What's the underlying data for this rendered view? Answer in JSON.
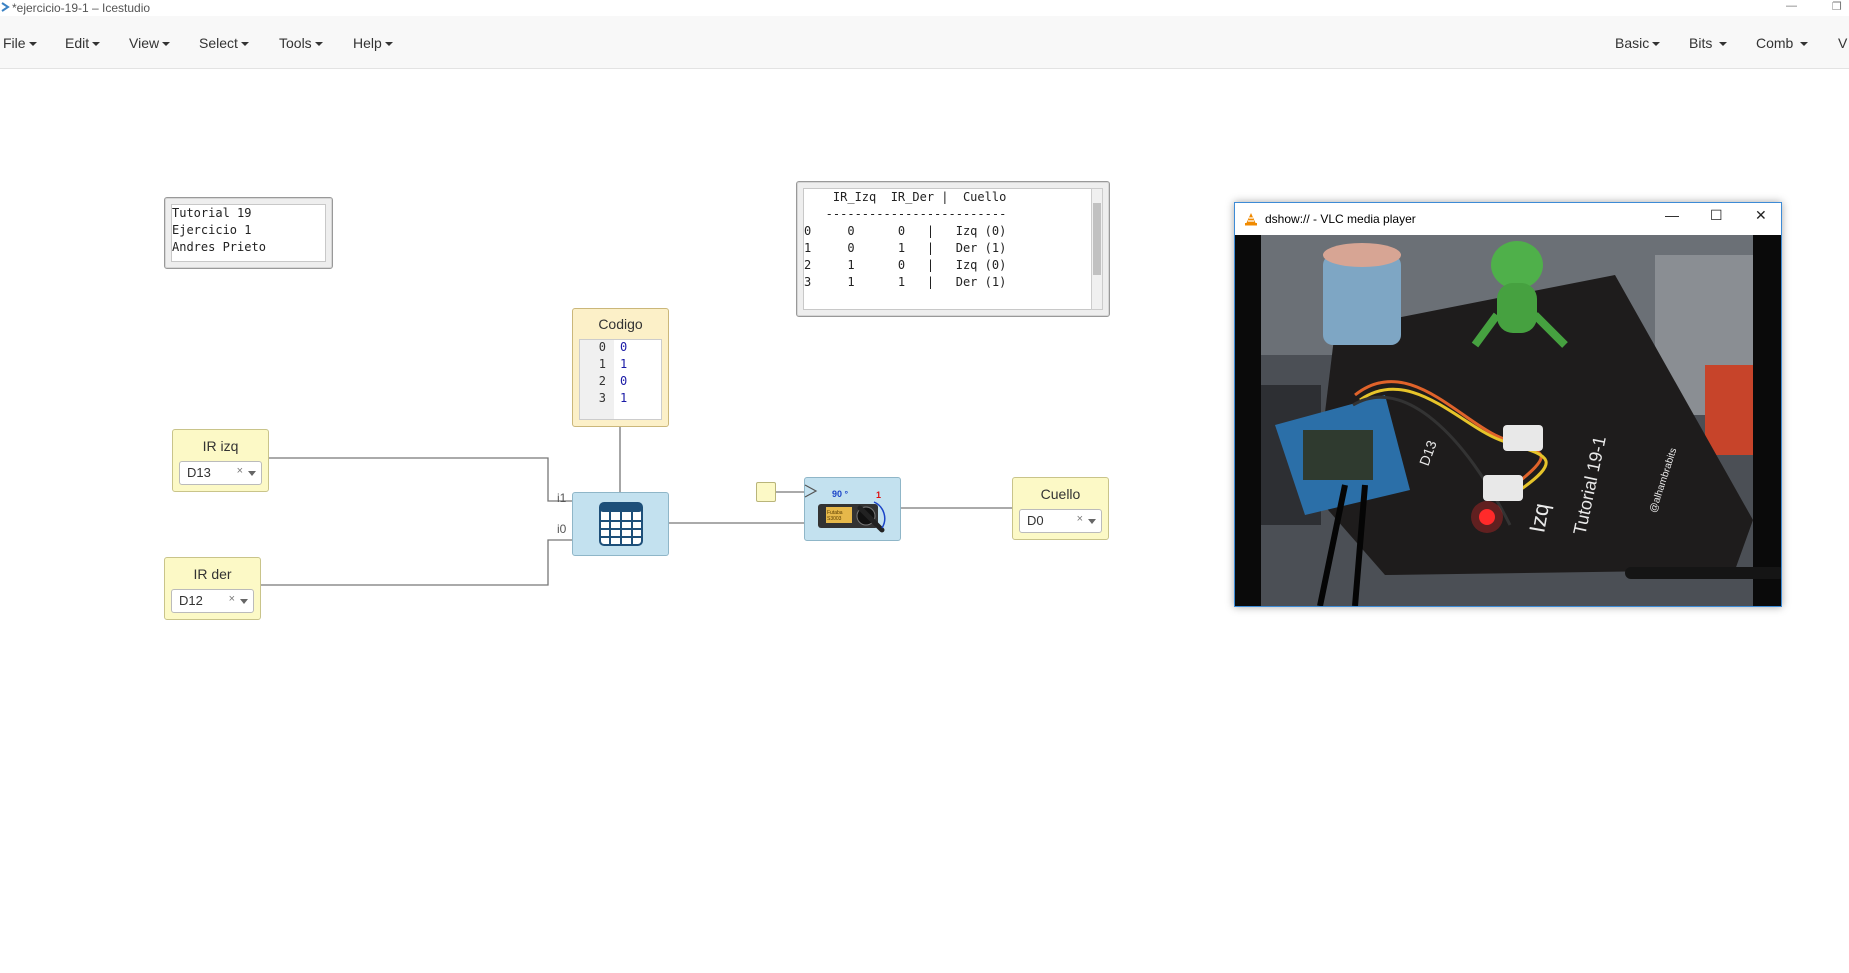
{
  "window": {
    "title": "*ejercicio-19-1 – Icestudio",
    "minimize_glyph": "—",
    "restore_glyph": "❐"
  },
  "menubar": {
    "left": [
      "File",
      "Edit",
      "View",
      "Select",
      "Tools",
      "Help"
    ],
    "right": [
      "Basic",
      "Bits",
      "Comb",
      "V"
    ]
  },
  "notes": {
    "info": "Tutorial 19\nEjercicio 1\nAndres Prieto",
    "truth_table": "    IR_Izq  IR_Der |  Cuello\n   -------------------------\n0     0      0   |   Izq (0)\n1     0      1   |   Der (1)\n2     1      0   |   Izq (0)\n3     1      1   |   Der (1)"
  },
  "blocks": {
    "ir_izq": {
      "label": "IR izq",
      "pin": "D13"
    },
    "ir_der": {
      "label": "IR der",
      "pin": "D12"
    },
    "codigo": {
      "label": "Codigo",
      "rows": [
        {
          "line": "0",
          "value": "0"
        },
        {
          "line": "1",
          "value": "1"
        },
        {
          "line": "2",
          "value": "0"
        },
        {
          "line": "3",
          "value": "1"
        }
      ]
    },
    "table_ports": {
      "i1": "i1",
      "i0": "i0"
    },
    "servo": {
      "angle": "90 °",
      "mark": "1",
      "brand": "Futaba\nS3003"
    },
    "cuello": {
      "label": "Cuello",
      "pin": "D0"
    },
    "clear_glyph": "×"
  },
  "vlc": {
    "title": "dshow:// - VLC media player",
    "minimize": "—",
    "maximize": "☐",
    "close": "✕",
    "video_labels": [
      "D13",
      "Izq",
      "Tutorial 19-1",
      "@alhambrabits"
    ]
  },
  "colors": {
    "io_block": "#fcf9c6",
    "code_block": "#fcf0c8",
    "blue_block": "#c3e1ef",
    "wire": "#777777",
    "vlc_border": "#3d8bd6"
  }
}
